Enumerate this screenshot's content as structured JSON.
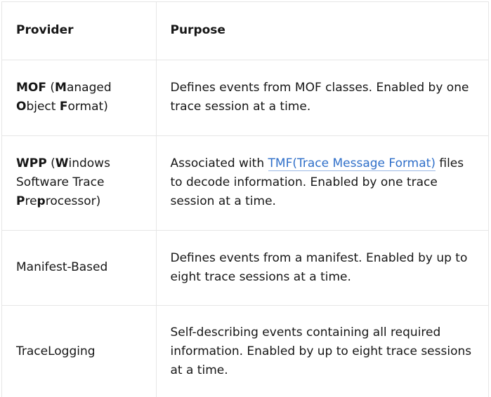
{
  "header": {
    "provider": "Provider",
    "purpose": "Purpose"
  },
  "rows": [
    {
      "provider": [
        {
          "t": "MOF",
          "b": true
        },
        {
          "t": " (",
          "b": false
        },
        {
          "t": "M",
          "b": true
        },
        {
          "t": "anaged",
          "b": false
        },
        {
          "t": "O",
          "b": true
        },
        {
          "t": "bject ",
          "b": false
        },
        {
          "t": "F",
          "b": true
        },
        {
          "t": "ormat)",
          "b": false
        }
      ],
      "provider_breaks": [
        4
      ],
      "purpose_before": "Defines events from MOF classes. Enabled by one trace session at a time.",
      "purpose_link": "",
      "purpose_after": ""
    },
    {
      "provider": [
        {
          "t": "WPP",
          "b": true
        },
        {
          "t": " (",
          "b": false
        },
        {
          "t": "W",
          "b": true
        },
        {
          "t": "indows",
          "b": false
        },
        {
          "t": "Software Trace ",
          "b": false
        },
        {
          "t": "P",
          "b": true
        },
        {
          "t": "re",
          "b": false
        },
        {
          "t": "p",
          "b": true
        },
        {
          "t": "rocessor)",
          "b": false
        }
      ],
      "provider_breaks": [
        4,
        5
      ],
      "purpose_before": "Associated with ",
      "purpose_link": "TMF(Trace Message Format)",
      "purpose_after": " files to decode information. Enabled by one trace session at a time."
    },
    {
      "provider": [
        {
          "t": "Manifest-Based",
          "b": false
        }
      ],
      "provider_breaks": [],
      "purpose_before": "Defines events from a manifest. Enabled by up to eight trace sessions at a time.",
      "purpose_link": "",
      "purpose_after": ""
    },
    {
      "provider": [
        {
          "t": "TraceLogging",
          "b": false
        }
      ],
      "provider_breaks": [],
      "purpose_before": "Self-describing events containing all required information. Enabled by up to eight trace sessions at a time.",
      "purpose_link": "",
      "purpose_after": ""
    }
  ]
}
